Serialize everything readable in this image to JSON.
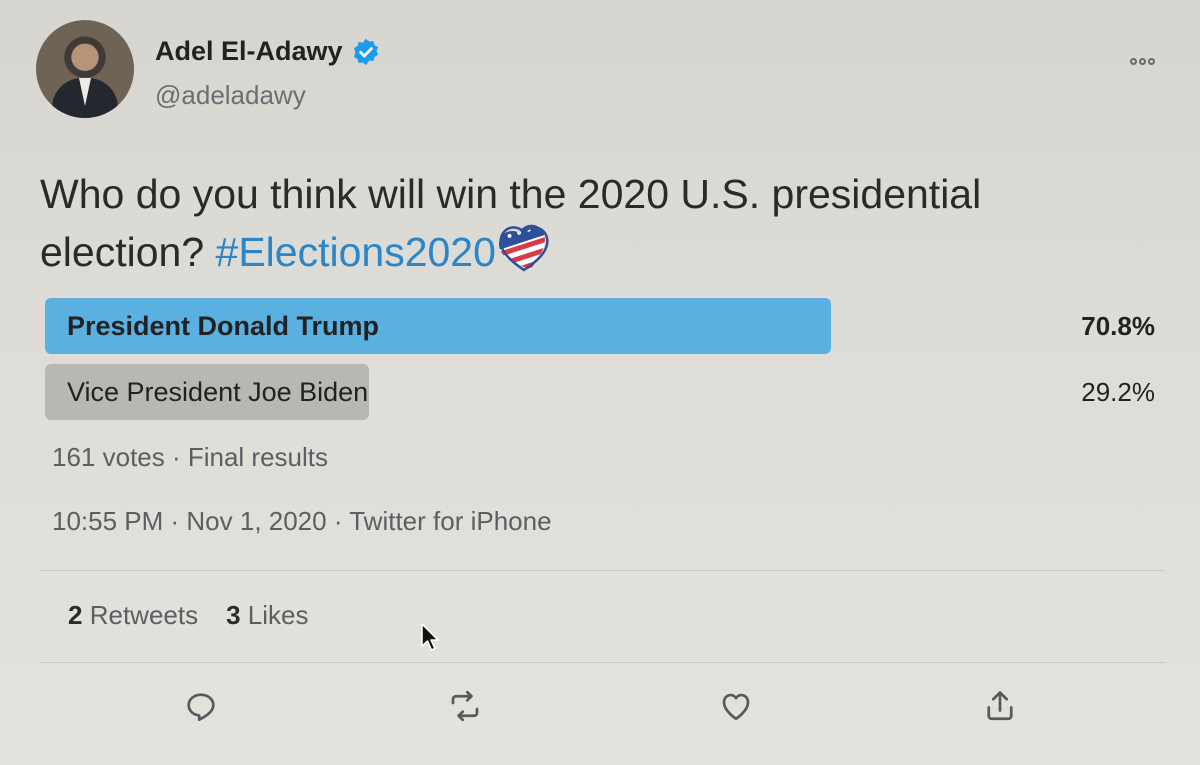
{
  "author": {
    "name": "Adel El-Adawy",
    "handle": "@adeladawy",
    "verified_icon": "verified-badge-icon"
  },
  "tweet": {
    "text": "Who do you think will win the 2020 U.S. presidential election?",
    "hashtag": "#Elections2020",
    "emoji": "us-flag-heart-icon"
  },
  "poll": {
    "options": [
      {
        "label": "President Donald Trump",
        "percent_text": "70.8%",
        "fraction": 0.708
      },
      {
        "label": "Vice President Joe Biden",
        "percent_text": "29.2%",
        "fraction": 0.292
      }
    ],
    "summary": "161 votes · Final results",
    "colors": {
      "winner": "#5ab1e1",
      "other": "#b8b7b3"
    }
  },
  "meta": {
    "timestamp": "10:55 PM · Nov 1, 2020 · Twitter for iPhone"
  },
  "stats": {
    "retweets_count": "2",
    "retweets_label": "Retweets",
    "likes_count": "3",
    "likes_label": "Likes"
  },
  "actions": [
    "reply-icon",
    "retweet-icon",
    "like-icon",
    "share-icon"
  ],
  "colors": {
    "accent": "#2a86c8",
    "verified": "#1d9bf0"
  }
}
